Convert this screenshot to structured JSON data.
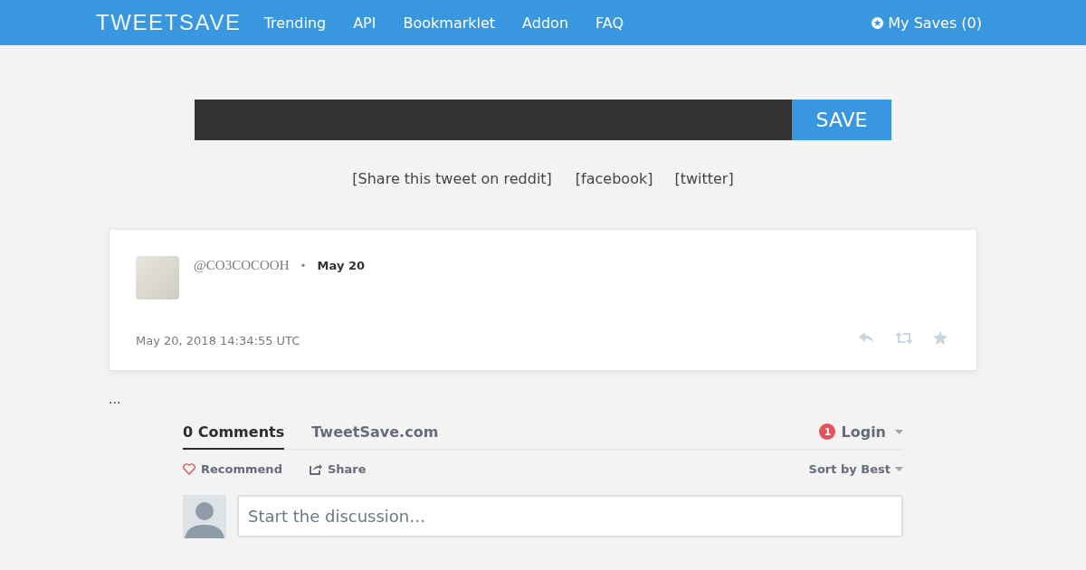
{
  "header": {
    "logo": "TWEETSAVE",
    "nav": [
      "Trending",
      "API",
      "Bookmarklet",
      "Addon",
      "FAQ"
    ],
    "my_saves": "My Saves (0)"
  },
  "save_form": {
    "button": "SAVE"
  },
  "share_links": [
    "[Share this tweet on reddit]",
    "[facebook]",
    "[twitter]"
  ],
  "tweet": {
    "handle": "@CO3COCOOH",
    "separator": "•",
    "date": "May 20",
    "timestamp": "May 20, 2018 14:34:55 UTC"
  },
  "ellipsis": "...",
  "comments": {
    "tabs": [
      {
        "label": "0 Comments",
        "selected": true
      },
      {
        "label": "TweetSave.com",
        "selected": false
      }
    ],
    "notification_count": "1",
    "login": "Login",
    "actions": [
      {
        "kind": "recommend",
        "label": "Recommend"
      },
      {
        "kind": "share",
        "label": "Share"
      }
    ],
    "sort": "Sort by Best",
    "composer": {
      "placeholder": "Start the discussion…"
    }
  }
}
